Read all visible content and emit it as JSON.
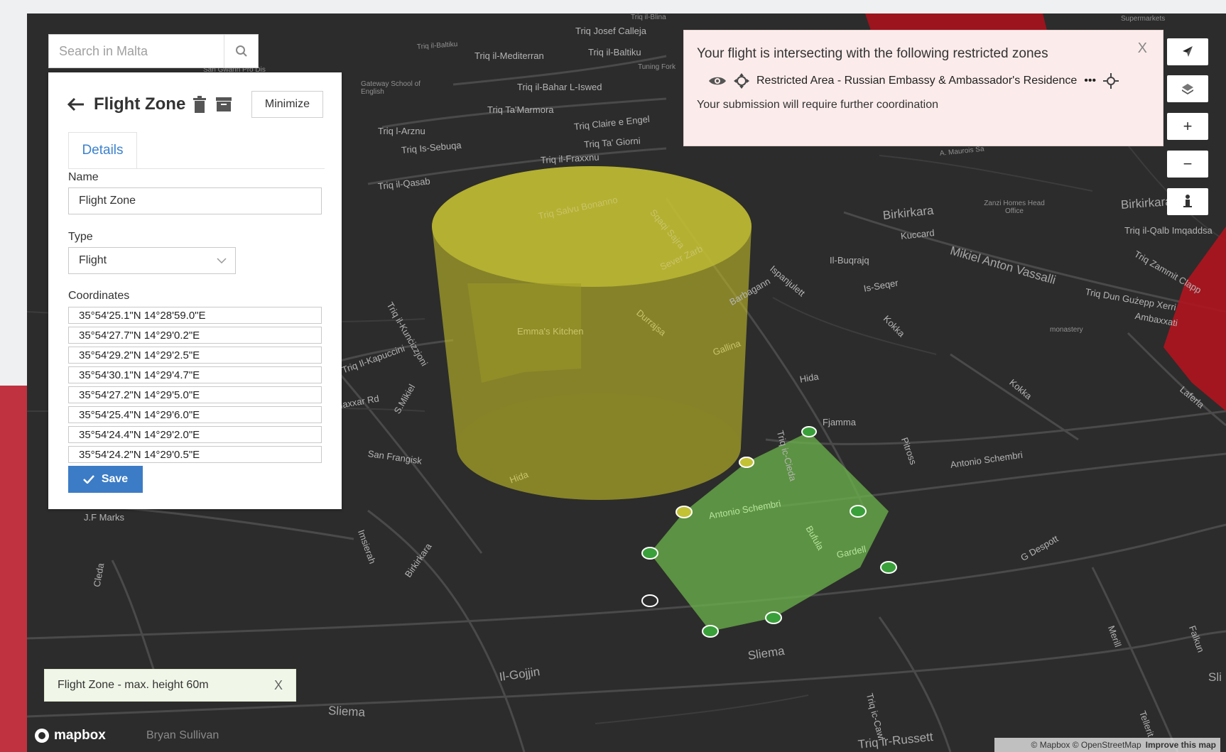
{
  "search": {
    "placeholder": "Search in Malta",
    "icon": "search-icon"
  },
  "panel": {
    "title": "Flight Zone",
    "minimize_label": "Minimize",
    "tab_label": "Details",
    "name_label": "Name",
    "name_value": "Flight Zone",
    "type_label": "Type",
    "type_value": "Flight",
    "coordinates_label": "Coordinates",
    "coordinates": [
      "35°54'25.1\"N 14°28'59.0\"E",
      "35°54'27.7\"N 14°29'0.2\"E",
      "35°54'29.2\"N 14°29'2.5\"E",
      "35°54'30.1\"N 14°29'4.7\"E",
      "35°54'27.2\"N 14°29'5.0\"E",
      "35°54'25.4\"N 14°29'6.0\"E",
      "35°54'24.4\"N 14°29'2.0\"E",
      "35°54'24.2\"N 14°29'0.5\"E"
    ],
    "save_label": "Save"
  },
  "alert": {
    "title": "Your flight is intersecting with the following restricted zones",
    "close": "X",
    "zone_name": "Restricted Area - Russian Embassy & Ambassador's Residence",
    "more": "•••",
    "footer": "Your submission will require further coordination"
  },
  "controls": [
    "compass-icon",
    "layers-icon",
    "+",
    "−",
    "person-icon"
  ],
  "chip": {
    "label": "Flight Zone - max. height 60m",
    "close": "X"
  },
  "brand": {
    "logo": "mapbox"
  },
  "owner": "Bryan Sullivan",
  "attribution": {
    "text": "© Mapbox © OpenStreetMap",
    "link": "Improve this map"
  },
  "streets": [
    "Triq il-Blina",
    "Triq Josef Calleja",
    "Triq il-Baltiku",
    "Triq il-Mediterran",
    "Triq il-Baltiku",
    "Tuning Fork",
    "Gateway School of English",
    "Triq il-Bahar L-Iswed",
    "Triq Ta'Marmora",
    "Triq l-Arznu",
    "Triq Claire e Engel",
    "Triq Is-Sebuqa",
    "Triq Ta' Giorni",
    "Triq il-Fraxxnu",
    "Triq il-Qasab",
    "Triq Salvu Bonanno",
    "Sqaqi Sajra",
    "Sever Zarb",
    "Emma's Kitchen",
    "Durrajsa",
    "Gallina",
    "Barbagann",
    "Ispanjulett",
    "Il-Buqrajq",
    "Is-Seqer",
    "Kokka",
    "Birkirkara",
    "Kuccard",
    "A. Maurois Sa",
    "Zanzi Homes Head Office",
    "Birkirkara",
    "Triq il-Qalb Imqaddsa",
    "Mikiel Anton Vassalli",
    "Triq Zammit Clapp",
    "Triq Dun Gużepp Xerri",
    "Ambaxxati",
    "monastery",
    "Kokka",
    "Laferla",
    "Hida",
    "Fjamma",
    "Pitross",
    "Antonio Schembri",
    "Antonio Schembri",
    "Bufula",
    "Gardell",
    "G Despott",
    "Triq Il-Kapuccini",
    "Naxxar Rd",
    "S.Mikiel",
    "San Frangisk",
    "Triq il-Kunċizzjoni",
    "Hida",
    "Imsierah",
    "Birkirkara",
    "J.F Marks",
    "Cleda",
    "Triq ic-Cieda",
    "Il-Gojjin",
    "Sliema",
    "Sliema",
    "Triq ic-Cawl",
    "Triq ir-Russett",
    "Tellerit",
    "Merill",
    "Falkun",
    "Supermarkets",
    "Sli",
    "San Gwann Pro Dis"
  ]
}
